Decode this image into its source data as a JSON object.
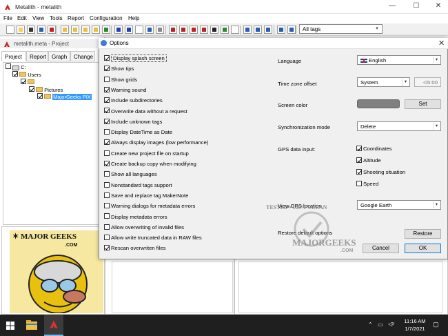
{
  "window": {
    "title": "Metalith - metalith",
    "min": "—",
    "max": "☐",
    "close": "✕"
  },
  "menu": [
    "File",
    "Edit",
    "View",
    "Tools",
    "Report",
    "Configuration",
    "Help"
  ],
  "toolbar": {
    "tag_filter": "All tags"
  },
  "project": {
    "title": "metalith.meta - Project",
    "tabs": [
      "Project",
      "Report",
      "Graph",
      "Change"
    ],
    "tree": [
      {
        "label": "C:",
        "level": 0,
        "checked": false
      },
      {
        "label": "Users",
        "level": 1,
        "checked": true
      },
      {
        "label": "",
        "level": 2,
        "checked": true
      },
      {
        "label": "Pictures",
        "level": 3,
        "checked": true
      },
      {
        "label": "MajorGeeks PIX",
        "level": 4,
        "checked": true
      }
    ]
  },
  "logo": {
    "top": "MAJOR GEEKS",
    "sub": ".COM"
  },
  "dialog": {
    "title": "Options",
    "close": "✕",
    "options": [
      {
        "label": "Display splash screen",
        "checked": true
      },
      {
        "label": "Show tips",
        "checked": true
      },
      {
        "label": "Show grids",
        "checked": false
      },
      {
        "label": "Warning sound",
        "checked": true
      },
      {
        "label": "Include subdirectories",
        "checked": true
      },
      {
        "label": "Overwrite data without a request",
        "checked": true
      },
      {
        "label": "Include unknown tags",
        "checked": true
      },
      {
        "label": "Display DateTime as Date",
        "checked": false
      },
      {
        "label": "Always display images (low performance)",
        "checked": true
      },
      {
        "label": "Create new project file on startup",
        "checked": false
      },
      {
        "label": "Create backup copy when modifying",
        "checked": true
      },
      {
        "label": "Show all languages",
        "checked": false
      },
      {
        "label": "Nonstandard tags support",
        "checked": false
      },
      {
        "label": "Save and replace tag MakerNote",
        "checked": false
      },
      {
        "label": "Warning dialogs for metadata errors",
        "checked": false
      },
      {
        "label": "Display metadata errors",
        "checked": false
      },
      {
        "label": "Allow overwriting of invalid files",
        "checked": false
      },
      {
        "label": "Allow write truncated data in RAW files",
        "checked": false
      },
      {
        "label": "Rescan overwriten files",
        "checked": true
      }
    ],
    "language_label": "Language",
    "language_value": "English",
    "timezone_label": "Time zone offset",
    "timezone_value": "System",
    "timezone_offset": "-05:00",
    "screen_color_label": "Screen color",
    "screen_color_hex": "#808080",
    "set_button": "Set",
    "sync_label": "Synchronization mode",
    "sync_value": "Delete",
    "gps_label": "GPS data input:",
    "gps_options": [
      {
        "label": "Coordinates",
        "checked": true
      },
      {
        "label": "Altitude",
        "checked": true
      },
      {
        "label": "Shooting situation",
        "checked": true
      },
      {
        "label": "Speed",
        "checked": false
      }
    ],
    "view_gps_label": "View GPS location",
    "view_gps_value": "Google Earth",
    "restore_label": "Restore default options",
    "restore_button": "Restore",
    "cancel_button": "Cancel",
    "ok_button": "OK"
  },
  "watermark": {
    "line1": "TESTED • 100% CLEAN",
    "line2": "MAJORGEEKS",
    "line3": ".COM"
  },
  "taskbar": {
    "time": "11:16 AM",
    "date": "1/7/2021"
  }
}
